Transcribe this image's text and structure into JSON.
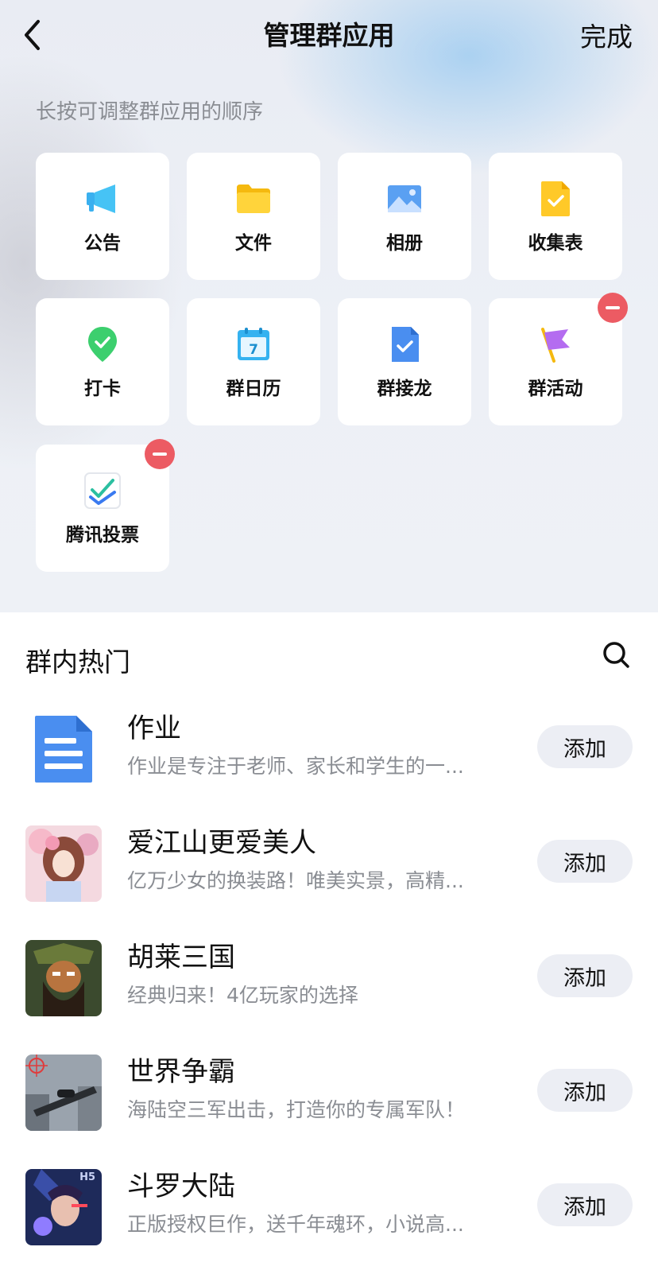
{
  "nav": {
    "title": "管理群应用",
    "done": "完成"
  },
  "hint": "长按可调整群应用的顺序",
  "apps": [
    {
      "label": "公告",
      "icon": "megaphone-icon"
    },
    {
      "label": "文件",
      "icon": "folder-icon"
    },
    {
      "label": "相册",
      "icon": "photo-album-icon"
    },
    {
      "label": "收集表",
      "icon": "collection-form-icon"
    },
    {
      "label": "打卡",
      "icon": "check-in-pin-icon"
    },
    {
      "label": "群日历",
      "icon": "calendar-icon"
    },
    {
      "label": "群接龙",
      "icon": "solitaire-doc-icon"
    },
    {
      "label": "群活动",
      "icon": "flag-icon",
      "removable": true
    },
    {
      "label": "腾讯投票",
      "icon": "vote-icon",
      "removable": true
    }
  ],
  "calendar_day": "7",
  "popular": {
    "title": "群内热门",
    "add_label": "添加",
    "items": [
      {
        "name": "作业",
        "desc": "作业是专注于老师、家长和学生的一..."
      },
      {
        "name": "爱江山更爱美人",
        "desc": "亿万少女的换装路！唯美实景，高精..."
      },
      {
        "name": "胡莱三国",
        "desc": "经典归来！4亿玩家的选择"
      },
      {
        "name": "世界争霸",
        "desc": "海陆空三军出击，打造你的专属军队！"
      },
      {
        "name": "斗罗大陆",
        "desc": "正版授权巨作，送千年魂环，小说高..."
      }
    ],
    "badge_h5": "H5"
  },
  "colors": {
    "accent_blue": "#4a8ef0",
    "remove_red": "#ec5b63",
    "button_bg": "#eceef4"
  }
}
